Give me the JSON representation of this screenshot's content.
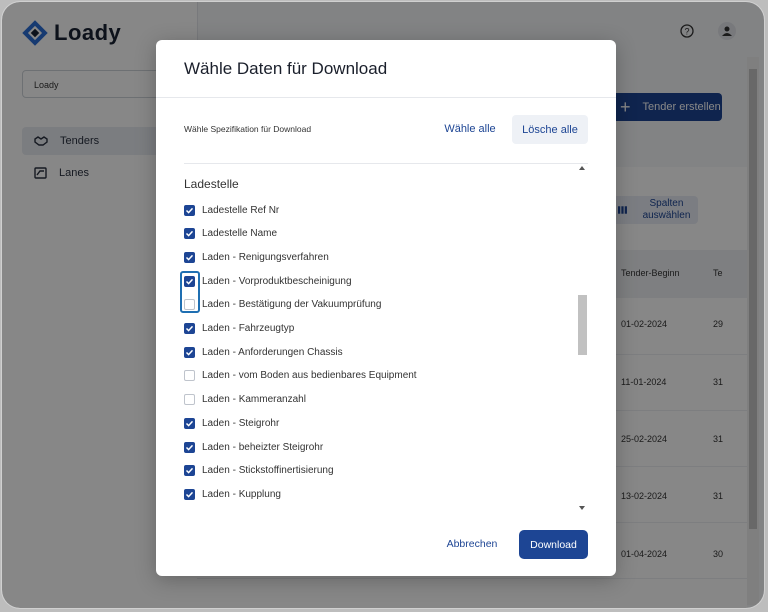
{
  "app": {
    "name": "Loady"
  },
  "sidebar": {
    "org_select": "Loady",
    "items": [
      {
        "label": "Tenders",
        "icon": "handshake-icon",
        "active": true
      },
      {
        "label": "Lanes",
        "icon": "route-icon",
        "active": false
      }
    ]
  },
  "header": {
    "help_icon": "help-icon",
    "user_icon": "user-icon",
    "create_button": "Tender erstellen"
  },
  "table": {
    "columns_button": "Spalten auswählen",
    "headers": [
      "Tender-Beginn",
      "Te"
    ],
    "rows": [
      {
        "start": "01-02-2024",
        "next": "29"
      },
      {
        "start": "11-01-2024",
        "next": "31"
      },
      {
        "start": "25-02-2024",
        "next": "31"
      },
      {
        "start": "13-02-2024",
        "next": "31"
      },
      {
        "start": "01-04-2024",
        "next": "30"
      }
    ]
  },
  "modal": {
    "title": "Wähle Daten für Download",
    "spec_label": "Wähle Spezifikation für Download",
    "select_all": "Wähle alle",
    "clear_all": "Lösche alle",
    "section": "Ladestelle",
    "options": [
      {
        "label": "Ladestelle Ref Nr",
        "checked": true
      },
      {
        "label": "Ladestelle Name",
        "checked": true
      },
      {
        "label": "Laden - Renigungsverfahren",
        "checked": true
      },
      {
        "label": "Laden - Vorproduktbescheinigung",
        "checked": true
      },
      {
        "label": "Laden - Bestätigung der Vakuumprüfung",
        "checked": false
      },
      {
        "label": "Laden - Fahrzeugtyp",
        "checked": true
      },
      {
        "label": "Laden - Anforderungen Chassis",
        "checked": true
      },
      {
        "label": "Laden - vom Boden aus bedienbares Equipment",
        "checked": false
      },
      {
        "label": "Laden - Kammeranzahl",
        "checked": false
      },
      {
        "label": "Laden - Steigrohr",
        "checked": true
      },
      {
        "label": "Laden - beheizter Steigrohr",
        "checked": true
      },
      {
        "label": "Laden - Stickstoffinertisierung",
        "checked": true
      },
      {
        "label": "Laden - Kupplung",
        "checked": true
      }
    ],
    "cancel": "Abbrechen",
    "download": "Download"
  },
  "colors": {
    "primary": "#1d4594",
    "focus": "#1f6fb2"
  }
}
